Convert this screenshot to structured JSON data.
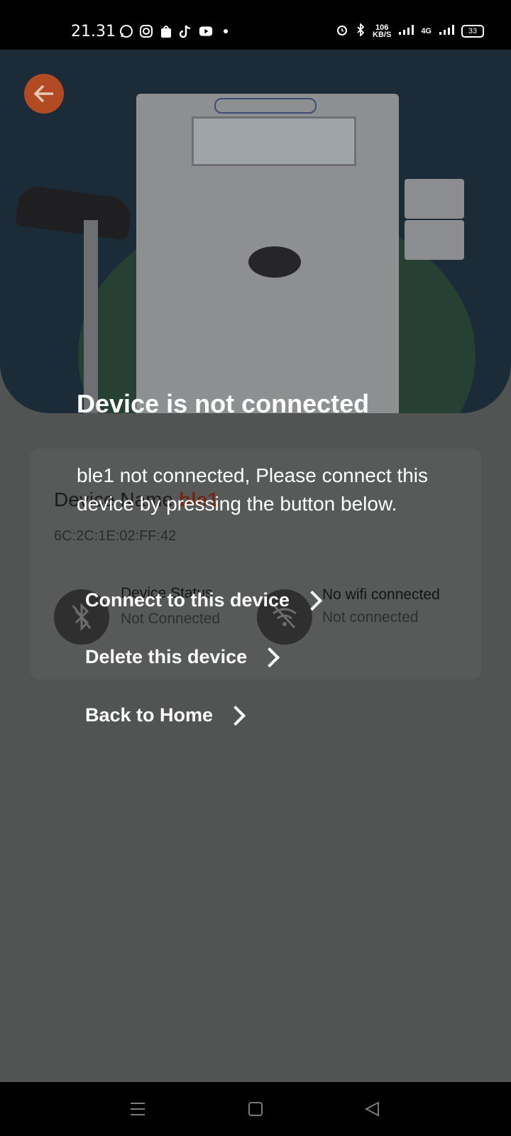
{
  "status_bar": {
    "time": "21.31",
    "apps": [
      "whatsapp-icon",
      "instagram-icon",
      "shopee-icon",
      "tiktok-icon",
      "youtube-icon",
      "dot-icon"
    ],
    "net_speed_value": "106",
    "net_speed_unit": "KB/S",
    "network": "4G",
    "battery": "33"
  },
  "hero": {
    "back_icon": "arrow-left-icon"
  },
  "device_card": {
    "name_label": "Device Name",
    "name_value": "ble1",
    "mac": "6C:2C:1E:02:FF:42",
    "device_status_title": "Device Status",
    "device_status_value": "Not Connected",
    "wifi_title": "No wifi connected",
    "wifi_value": "Not connected"
  },
  "dialog": {
    "title": "Device is not connected",
    "message": "ble1 not connected, Please connect this device by pressing the button below.",
    "actions": [
      {
        "label": "Connect to this device"
      },
      {
        "label": "Delete this device"
      },
      {
        "label": "Back to Home"
      }
    ]
  },
  "nav": {
    "icons": [
      "menu-icon",
      "home-square-icon",
      "back-triangle-icon"
    ]
  },
  "colors": {
    "accent": "#e3642e",
    "overlay": "#525353"
  }
}
